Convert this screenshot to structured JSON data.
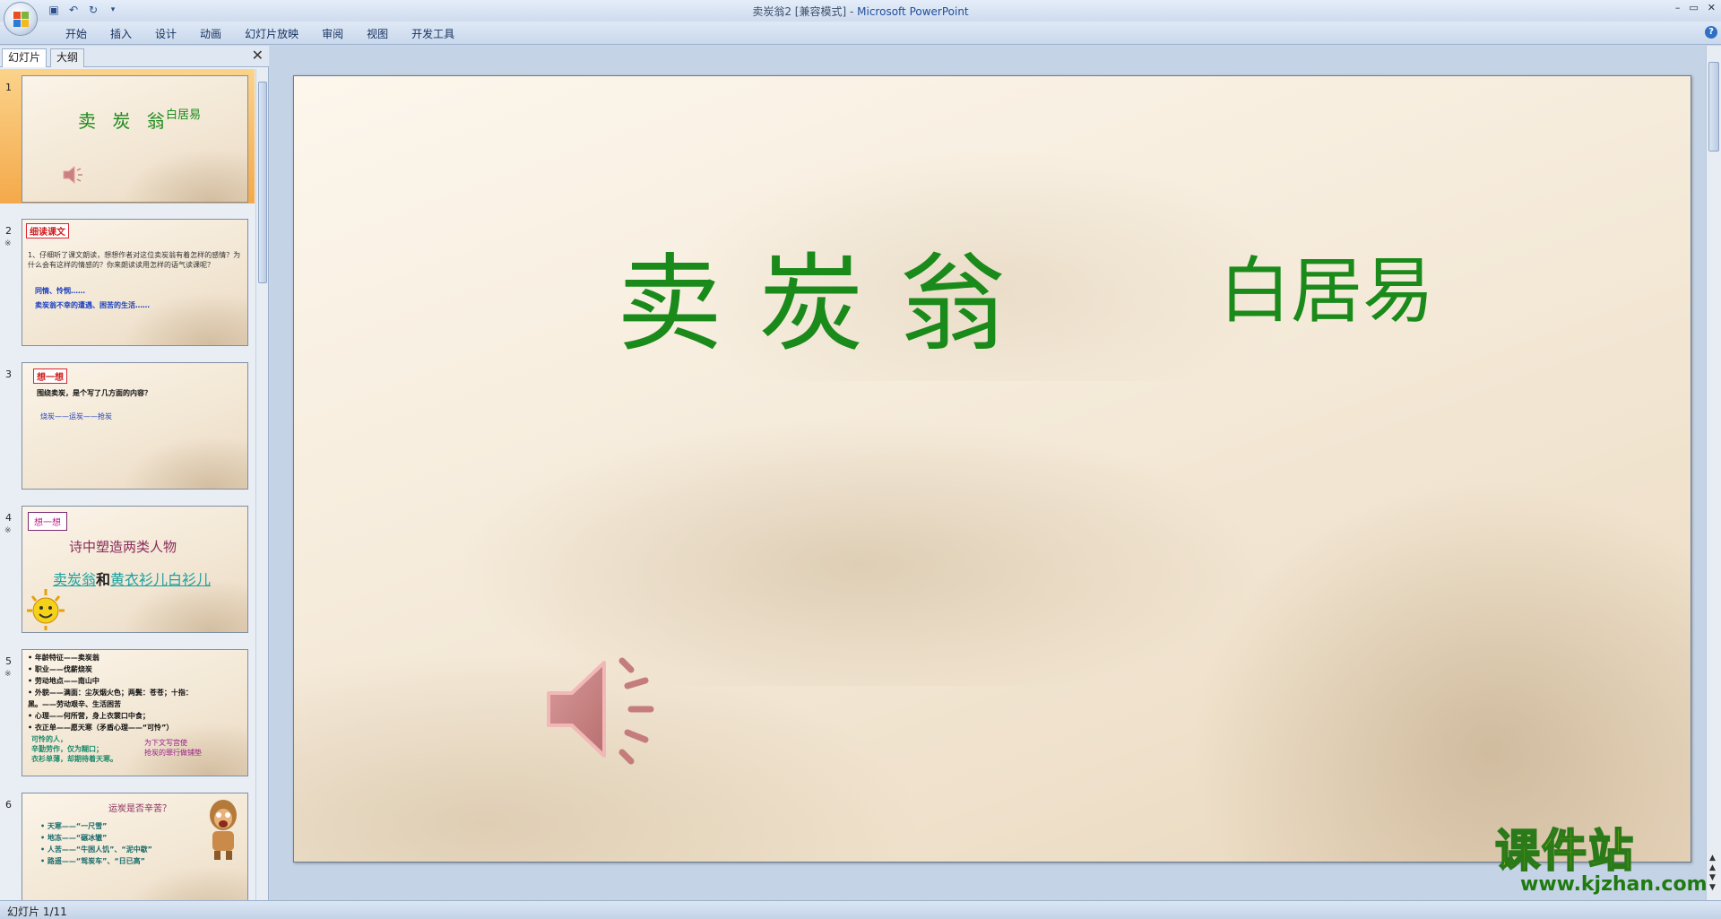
{
  "window": {
    "title_doc": "卖炭翁2 [兼容模式]",
    "title_sep": " - ",
    "title_app": "Microsoft PowerPoint",
    "controls": [
      "–",
      "▭",
      "✕"
    ]
  },
  "ribbon": {
    "tabs": [
      "开始",
      "插入",
      "设计",
      "动画",
      "幻灯片放映",
      "审阅",
      "视图",
      "开发工具"
    ]
  },
  "panel": {
    "tab_slides": "幻灯片",
    "tab_outline": "大纲",
    "close": "✕",
    "thumbnails": [
      {
        "num": "1",
        "anim": "",
        "title": "卖 炭 翁",
        "author": "白居易"
      },
      {
        "num": "2",
        "anim": "※",
        "label": "细读课文",
        "body": "1、仔细听了课文朗读，想想作者对这位卖炭翁有着怎样的感情？为什么会有这样的情感的？你来朗读读用怎样的语气读课呢？",
        "line1": "同情、怜悯……",
        "line2": "卖炭翁不幸的遭遇、困苦的生活……"
      },
      {
        "num": "3",
        "anim": "",
        "label": "想一想",
        "body": "围绕卖炭，是个写了几方面的内容？",
        "line1": "烧炭——运炭——抢炭"
      },
      {
        "num": "4",
        "anim": "※",
        "label": "想一想",
        "body": "诗中塑造两类人物",
        "line1a": "卖炭翁",
        "line1b": "和",
        "line1c": "黄衣衫儿白衫儿"
      },
      {
        "num": "5",
        "anim": "※",
        "lines": [
          "• 年龄特征——卖炭翁",
          "• 职业——伐薪烧炭",
          "• 劳动地点——南山中",
          "• 外貌——满面：尘灰烟火色；两鬓：苍苍；十指：",
          "  黑。——劳动艰辛、生活困苦",
          "• 心理——何所营，身上衣裳口中食；",
          "• 衣正单——愿天寒（矛盾心理——“可怜”）"
        ],
        "green1": "可怜的人，",
        "green2": "辛勤劳作，仅为糊口；",
        "green3": "衣衫单薄，却期待着天寒。",
        "purple1": "为下文写宫使",
        "purple2": "抢炭的罪行做铺垫"
      },
      {
        "num": "6",
        "anim": "",
        "title": "运炭是否辛苦？",
        "lines": [
          "• 天寒——“一尺雪”",
          "• 地冻——“碾冰辙”",
          "• 人苦——“牛困人饥”、“泥中歇”",
          "• 路遥——“驾炭车”、“日已高”"
        ]
      }
    ]
  },
  "slide": {
    "title": "卖炭翁",
    "author": "白居易"
  },
  "status": {
    "text": "幻灯片 1/11"
  },
  "watermark": {
    "cn": "课件站",
    "url": "www.kjzhan.com"
  },
  "colors": {
    "title_green": "#1a8a1a",
    "ribbon_blue": "#c9d8ec",
    "selected_orange": "#f4a94a"
  }
}
